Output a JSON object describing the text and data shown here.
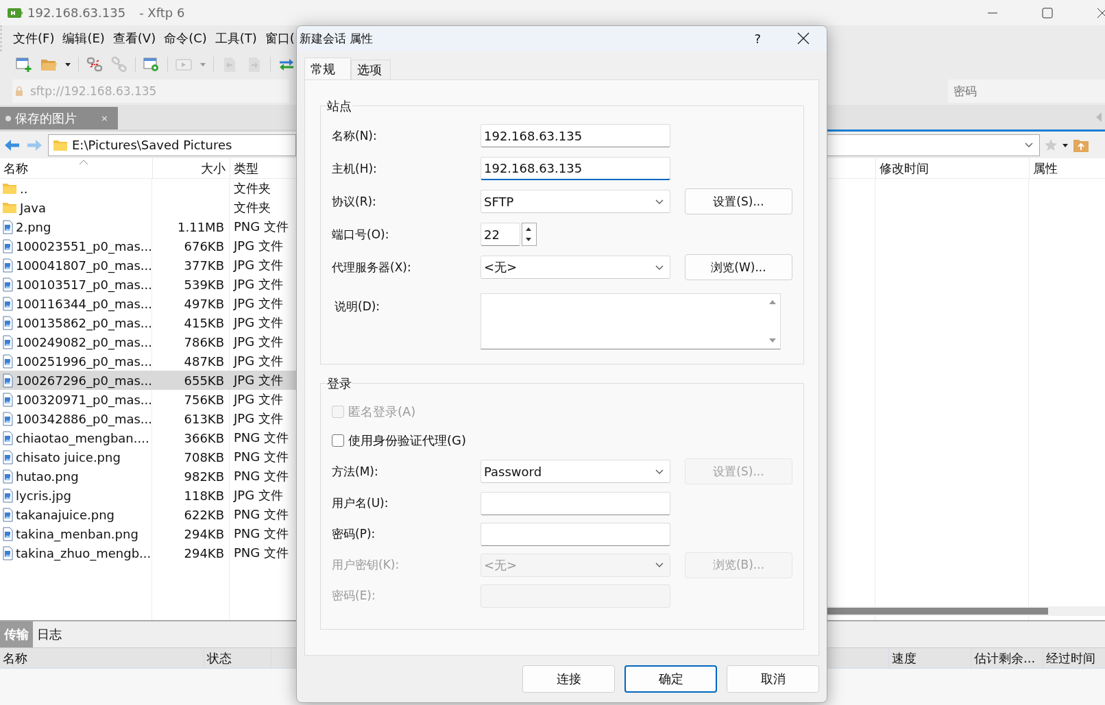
{
  "window": {
    "title": "192.168.63.135",
    "app_name": "- Xftp 6"
  },
  "menu": [
    "文件(F)",
    "编辑(E)",
    "查看(V)",
    "命令(C)",
    "工具(T)",
    "窗口("
  ],
  "address": {
    "url": "sftp://192.168.63.135",
    "password_placeholder": "密码"
  },
  "local_tab": {
    "label": "保存的图片",
    "close": "×"
  },
  "local_path": "E:\\Pictures\\Saved Pictures",
  "local_table": {
    "columns": [
      "名称",
      "大小",
      "类型"
    ],
    "rows": [
      {
        "kind": "folder",
        "name": "..",
        "type": "文件夹",
        "selected": false
      },
      {
        "kind": "folder",
        "name": "Java",
        "type": "文件夹",
        "selected": false
      },
      {
        "kind": "image",
        "name": "2.png",
        "size": "1.11MB",
        "type": "PNG 文件",
        "selected": false
      },
      {
        "kind": "image",
        "name": "100023551_p0_mas...",
        "size": "676KB",
        "type": "JPG 文件",
        "selected": false
      },
      {
        "kind": "image",
        "name": "100041807_p0_mas...",
        "size": "377KB",
        "type": "JPG 文件",
        "selected": false
      },
      {
        "kind": "image",
        "name": "100103517_p0_mas...",
        "size": "539KB",
        "type": "JPG 文件",
        "selected": false
      },
      {
        "kind": "image",
        "name": "100116344_p0_mas...",
        "size": "497KB",
        "type": "JPG 文件",
        "selected": false
      },
      {
        "kind": "image",
        "name": "100135862_p0_mas...",
        "size": "415KB",
        "type": "JPG 文件",
        "selected": false
      },
      {
        "kind": "image",
        "name": "100249082_p0_mas...",
        "size": "786KB",
        "type": "JPG 文件",
        "selected": false
      },
      {
        "kind": "image",
        "name": "100251996_p0_mas...",
        "size": "487KB",
        "type": "JPG 文件",
        "selected": false
      },
      {
        "kind": "image",
        "name": "100267296_p0_mas...",
        "size": "655KB",
        "type": "JPG 文件",
        "selected": true
      },
      {
        "kind": "image",
        "name": "100320971_p0_mas...",
        "size": "756KB",
        "type": "JPG 文件",
        "selected": false
      },
      {
        "kind": "image",
        "name": "100342886_p0_mas...",
        "size": "613KB",
        "type": "JPG 文件",
        "selected": false
      },
      {
        "kind": "image",
        "name": "chiaotao_mengban....",
        "size": "366KB",
        "type": "PNG 文件",
        "selected": false
      },
      {
        "kind": "image",
        "name": "chisato juice.png",
        "size": "708KB",
        "type": "PNG 文件",
        "selected": false
      },
      {
        "kind": "image",
        "name": "hutao.png",
        "size": "982KB",
        "type": "PNG 文件",
        "selected": false
      },
      {
        "kind": "image",
        "name": "lycris.jpg",
        "size": "118KB",
        "type": "JPG 文件",
        "selected": false
      },
      {
        "kind": "image",
        "name": "takanajuice.png",
        "size": "622KB",
        "type": "PNG 文件",
        "selected": false
      },
      {
        "kind": "image",
        "name": "takina_menban.png",
        "size": "294KB",
        "type": "PNG 文件",
        "selected": false
      },
      {
        "kind": "image",
        "name": "takina_zhuo_mengb...",
        "size": "294KB",
        "type": "PNG 文件",
        "selected": false
      }
    ]
  },
  "remote_table": {
    "columns": [
      "修改时间",
      "属性"
    ]
  },
  "transfer_tabs": [
    {
      "label": "传输",
      "selected": true
    },
    {
      "label": "日志",
      "selected": false
    }
  ],
  "transfer_columns_left": [
    "名称",
    "状态"
  ],
  "transfer_columns_right": [
    "速度",
    "估计剩余...",
    "经过时间"
  ],
  "dialog": {
    "title": "新建会话 属性",
    "help": "?",
    "tabs": [
      {
        "label": "常规",
        "selected": true
      },
      {
        "label": "选项",
        "selected": false
      }
    ],
    "site": {
      "legend": "站点",
      "fields": [
        {
          "kind": "text",
          "label": "名称(N):",
          "value": "192.168.63.135",
          "focused": false
        },
        {
          "kind": "text",
          "label": "主机(H):",
          "value": "192.168.63.135",
          "focused": true
        },
        {
          "kind": "select",
          "label": "协议(R):",
          "value": "SFTP",
          "button": "设置(S)..."
        },
        {
          "kind": "spin",
          "label": "端口号(O):",
          "value": "22"
        },
        {
          "kind": "select",
          "label": "代理服务器(X):",
          "value": "<无>",
          "button": "浏览(W)..."
        },
        {
          "kind": "textarea",
          "label": "说明(D):"
        }
      ]
    },
    "login": {
      "legend": "登录",
      "fields": [
        {
          "kind": "check",
          "label": "匿名登录(A)",
          "checked": false,
          "disabled": true
        },
        {
          "kind": "check",
          "label": "使用身份验证代理(G)",
          "checked": false,
          "disabled": false
        },
        {
          "kind": "select",
          "label": "方法(M):",
          "value": "Password",
          "disabled": false,
          "button": "设置(S)...",
          "button_disabled": true
        },
        {
          "kind": "text",
          "label": "用户名(U):",
          "disabled": false
        },
        {
          "kind": "text",
          "label": "密码(P):",
          "disabled": false
        },
        {
          "kind": "select",
          "label": "用户密钥(K):",
          "value": "<无>",
          "disabled": true,
          "button": "浏览(B)...",
          "button_disabled": true
        },
        {
          "kind": "text",
          "label": "密码(E):",
          "disabled": true
        }
      ]
    },
    "buttons": [
      {
        "label": "连接",
        "default": false
      },
      {
        "label": "确定",
        "default": true
      },
      {
        "label": "取消",
        "default": false
      }
    ]
  }
}
